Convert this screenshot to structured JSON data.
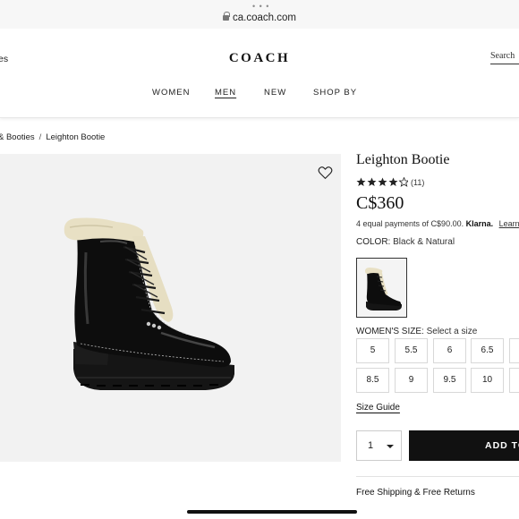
{
  "browser": {
    "url": "ca.coach.com"
  },
  "header": {
    "left_text": "es",
    "logo": "COACH",
    "search_label": "Search",
    "nav": [
      {
        "label": "WOMEN"
      },
      {
        "label": "MEN"
      },
      {
        "label": "NEW"
      },
      {
        "label": "SHOP BY"
      }
    ]
  },
  "breadcrumb": {
    "items": [
      "& Booties",
      "Leighton Bootie"
    ],
    "separator": "/"
  },
  "product": {
    "title": "Leighton Bootie",
    "rating": 4.5,
    "review_count": "(11)",
    "price": "C$360",
    "installments_text": "4 equal payments of C$90.00.",
    "klarna": "Klarna.",
    "learn": "Learn",
    "color_label": "COLOR:",
    "color_value": "Black & Natural",
    "size_label": "WOMEN'S SIZE:",
    "size_value": "Select a size",
    "sizes_row1": [
      "5",
      "5.5",
      "6",
      "6.5"
    ],
    "sizes_row2": [
      "8.5",
      "9",
      "9.5",
      "10"
    ],
    "size_guide": "Size Guide",
    "quantity": "1",
    "add_to_bag": "ADD TO",
    "shipping": "Free Shipping & Free Returns"
  },
  "colors": {
    "primary": "#111111",
    "image_bg": "#f2f2f2"
  },
  "icons": {
    "favorite": "heart-icon",
    "secure": "lock-icon",
    "dropdown": "chevron-down-icon"
  }
}
